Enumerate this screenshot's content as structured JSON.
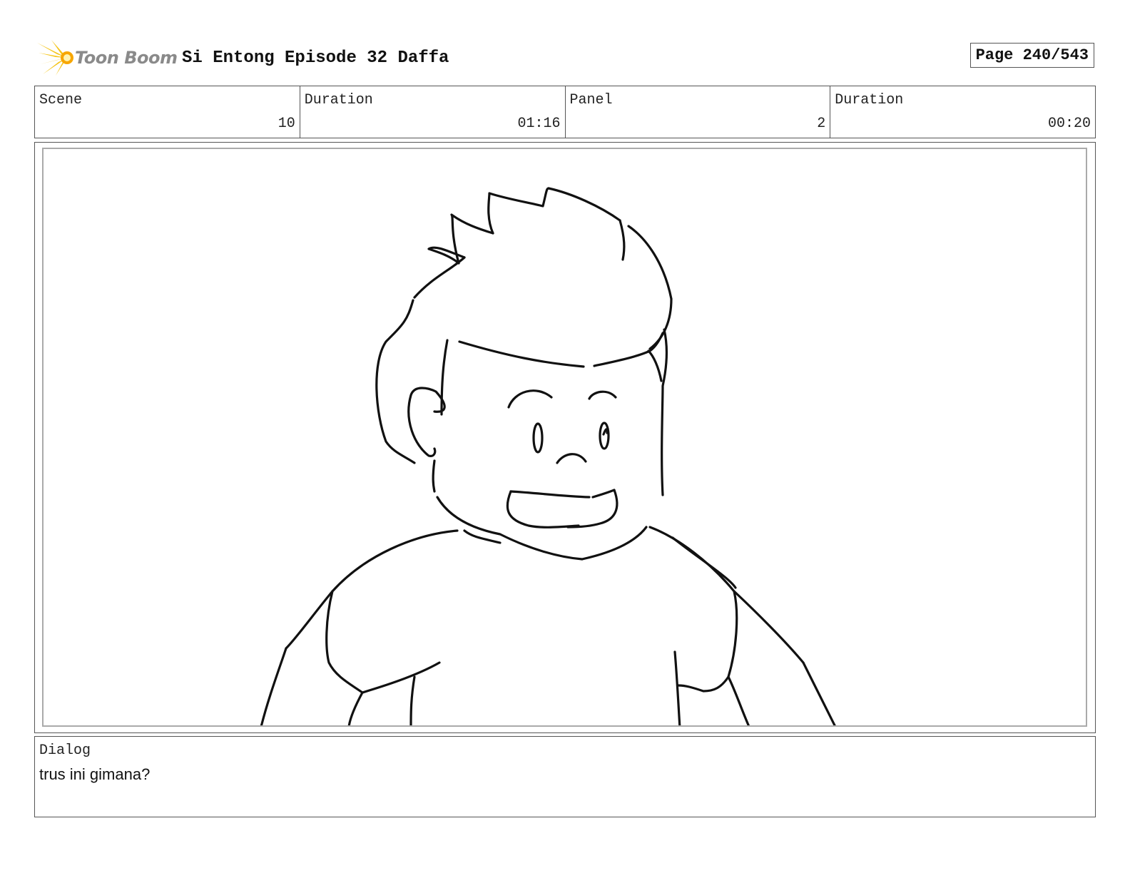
{
  "header": {
    "logo_text": "Toon Boom",
    "title": "Si Entong Episode 32 Daffa",
    "page_label": "Page 240/543"
  },
  "info": [
    {
      "label": "Scene",
      "value": "10"
    },
    {
      "label": "Duration",
      "value": "01:16"
    },
    {
      "label": "Panel",
      "value": "2"
    },
    {
      "label": "Duration",
      "value": "00:20"
    }
  ],
  "dialog": {
    "label": "Dialog",
    "text": "trus ini gimana?"
  },
  "colors": {
    "logo_flare": "#f5c518",
    "logo_text": "#8a8a8a",
    "border": "#555555"
  },
  "icons": {
    "logo": "toon-boom-flare-icon"
  }
}
